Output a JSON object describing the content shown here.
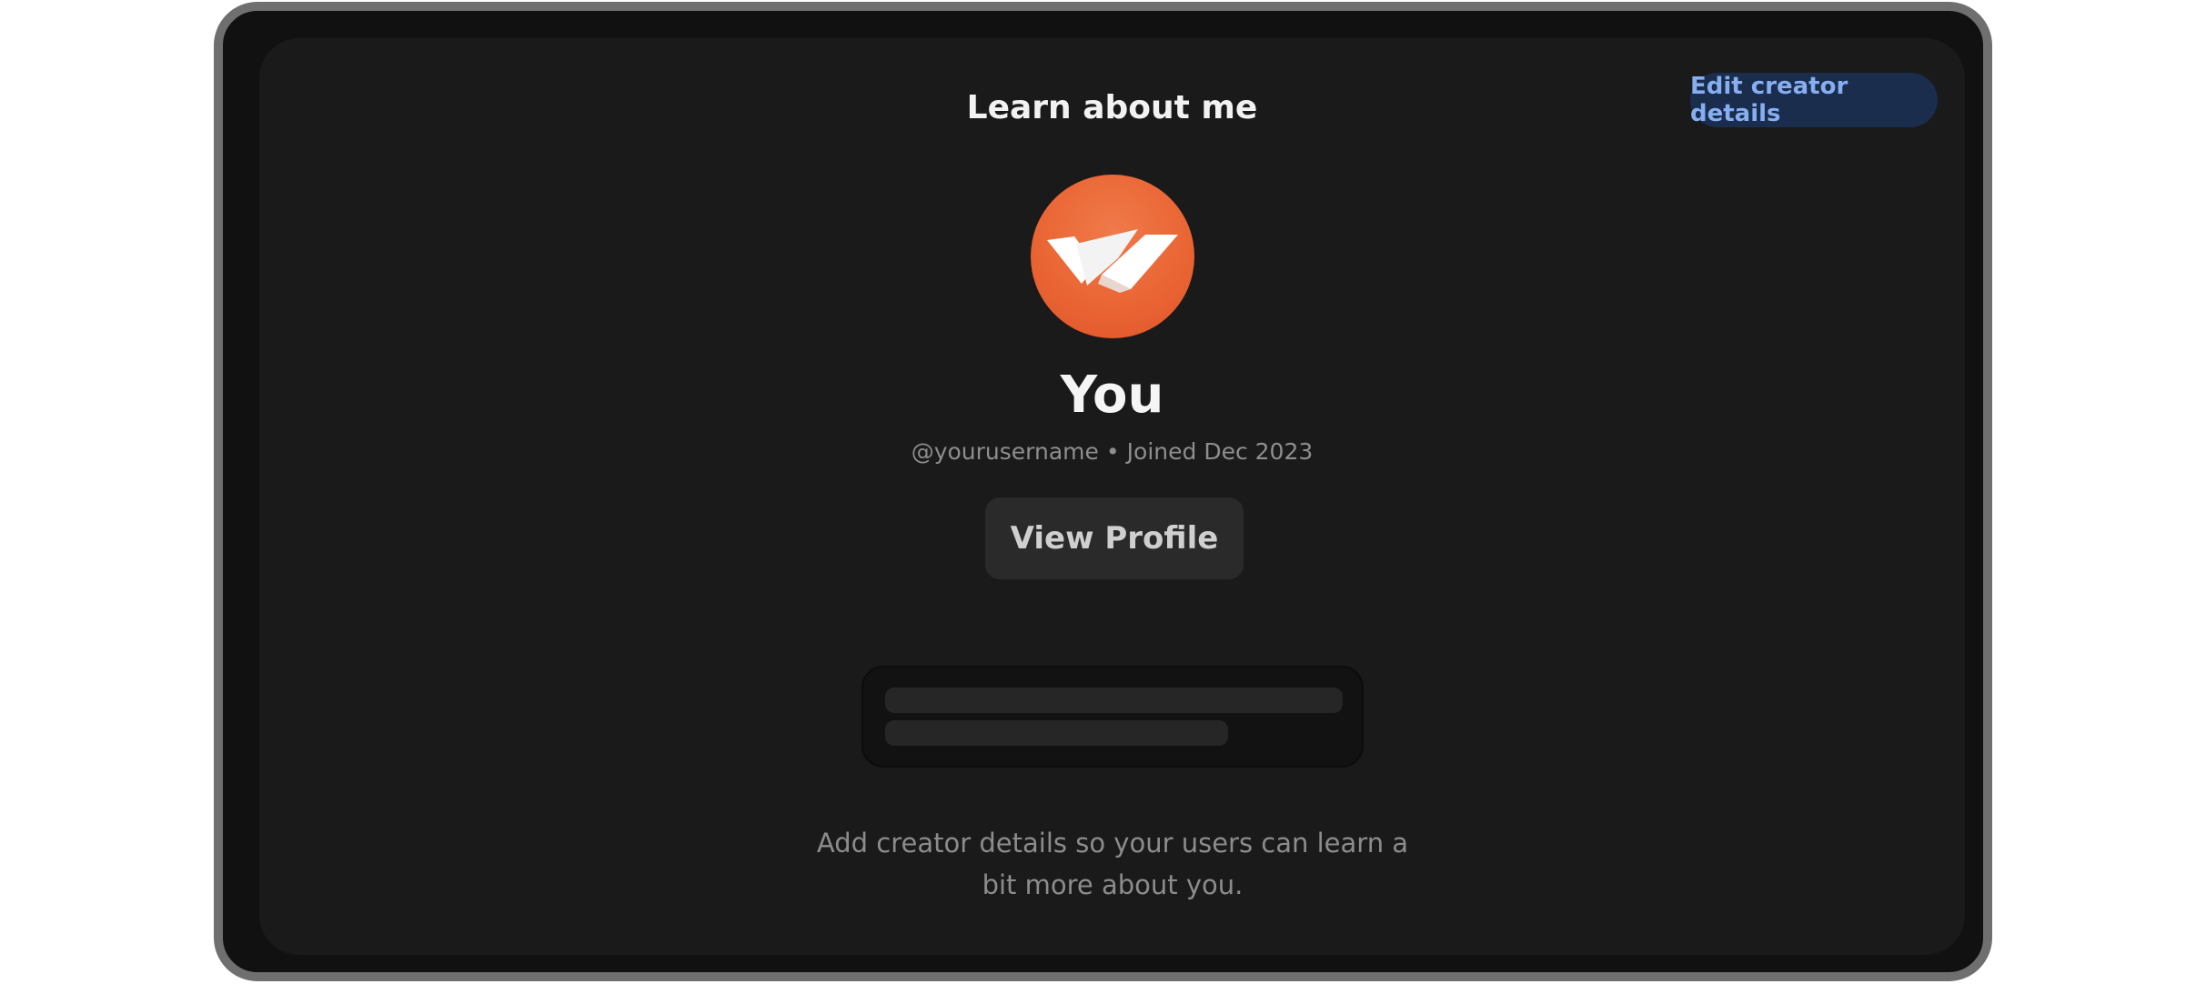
{
  "header": {
    "title": "Learn about me",
    "edit_button_label": "Edit creator details"
  },
  "profile": {
    "avatar_icon": "brand-logo-icon",
    "name": "You",
    "username": "@yourusername",
    "separator": "•",
    "joined": "Joined Dec 2023",
    "view_profile_label": "View Profile"
  },
  "details": {
    "empty_hint": "Add creator details so your users can learn a bit more about you."
  },
  "colors": {
    "panel_bg": "#1a1a1a",
    "accent_button_bg": "#1a2d4d",
    "accent_button_text": "#86aef0",
    "avatar_orange": "#ea6534"
  }
}
